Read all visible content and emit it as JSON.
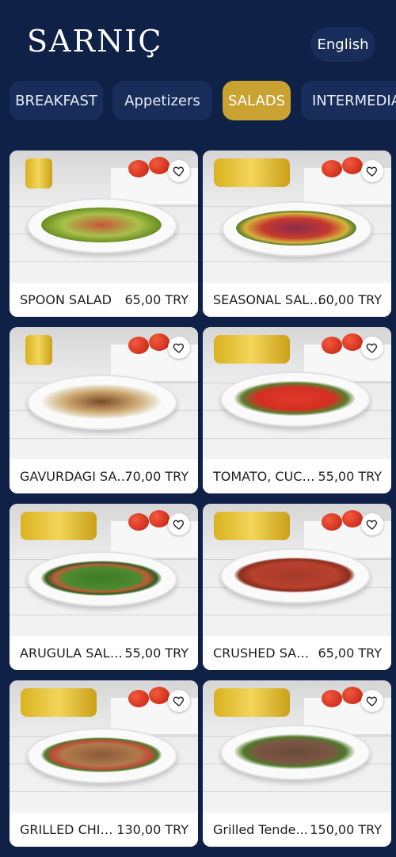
{
  "header": {
    "logo": "SARNIÇ",
    "language_label": "English"
  },
  "tabs": [
    {
      "label": "BREAKFAST",
      "active": false
    },
    {
      "label": "Appetizers",
      "active": false
    },
    {
      "label": "SALADS",
      "active": true
    },
    {
      "label": "INTERMEDIAT",
      "active": false
    }
  ],
  "products": [
    {
      "name": "SPOON SALAD",
      "price": "65,00 TRY"
    },
    {
      "name": "SEASONAL SALAD",
      "price": "60,00 TRY"
    },
    {
      "name": "GAVURDAGI SALAD",
      "price": "70,00 TRY"
    },
    {
      "name": "TOMATO, CUCUM...",
      "price": "55,00 TRY"
    },
    {
      "name": "ARUGULA SALAD",
      "price": "55,00 TRY"
    },
    {
      "name": "CRUSHED SALAD",
      "price": "65,00 TRY"
    },
    {
      "name": "GRILLED CHICK...",
      "price": "130,00 TRY"
    },
    {
      "name": "Grilled Tende...",
      "price": "150,00 TRY"
    }
  ],
  "icons": {
    "favorite": "heart-outline-icon"
  },
  "colors": {
    "background": "#0f2147",
    "tab_inactive": "#182d5a",
    "tab_active": "#c9a232",
    "card": "#ffffff"
  }
}
